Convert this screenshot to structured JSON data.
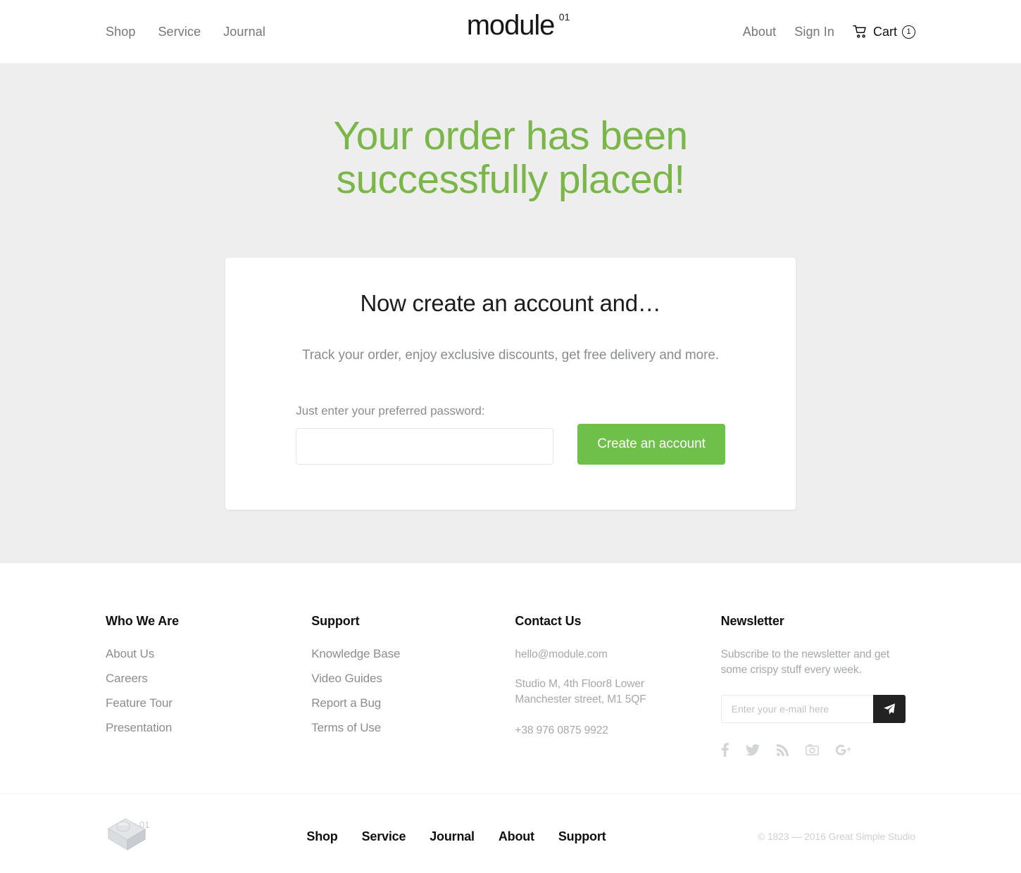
{
  "header": {
    "nav_left": [
      {
        "label": "Shop"
      },
      {
        "label": "Service"
      },
      {
        "label": "Journal"
      }
    ],
    "logo": {
      "text": "module",
      "superscript": "01"
    },
    "nav_right": [
      {
        "label": "About"
      },
      {
        "label": "Sign In"
      }
    ],
    "cart": {
      "label": "Cart",
      "count": "1",
      "icon": "cart-icon"
    }
  },
  "hero": {
    "title_line1": "Your order has been",
    "title_line2": "successfully placed!",
    "accent_color": "#7ab648",
    "background_color": "#eeeeee"
  },
  "card": {
    "title": "Now create an account and…",
    "subtitle": "Track your order, enjoy exclusive discounts, get free delivery and more.",
    "password_label": "Just enter your preferred password:",
    "password_value": "",
    "password_placeholder": "",
    "submit_label": "Create an account",
    "submit_color": "#6fc04a"
  },
  "footer": {
    "columns": [
      {
        "title": "Who We Are",
        "links": [
          {
            "label": "About Us"
          },
          {
            "label": "Careers"
          },
          {
            "label": "Feature Tour"
          },
          {
            "label": "Presentation"
          }
        ]
      },
      {
        "title": "Support",
        "links": [
          {
            "label": "Knowledge Base"
          },
          {
            "label": "Video Guides"
          },
          {
            "label": "Report a Bug"
          },
          {
            "label": "Terms of Use"
          }
        ]
      }
    ],
    "contact": {
      "title": "Contact Us",
      "email": "hello@module.com",
      "address_line1": "Studio M, 4th Floor8 Lower",
      "address_line2": "Manchester street, M1 5QF",
      "phone": "+38 976 0875 9922"
    },
    "newsletter": {
      "title": "Newsletter",
      "description_line1": "Subscribe to the newsletter and get",
      "description_line2": "some crispy stuff every week.",
      "input_value": "",
      "input_placeholder": "Enter your e-mail here",
      "submit_icon": "send-icon",
      "submit_color": "#222222",
      "social": [
        {
          "name": "facebook-icon"
        },
        {
          "name": "twitter-icon"
        },
        {
          "name": "rss-icon"
        },
        {
          "name": "instagram-icon"
        },
        {
          "name": "google-plus-icon"
        }
      ]
    }
  },
  "bottombar": {
    "brand_superscript": "01",
    "links": [
      {
        "label": "Shop"
      },
      {
        "label": "Service"
      },
      {
        "label": "Journal"
      },
      {
        "label": "About"
      },
      {
        "label": "Support"
      }
    ],
    "copyright": "© 1823 — 2016 Great Simple Studio"
  }
}
